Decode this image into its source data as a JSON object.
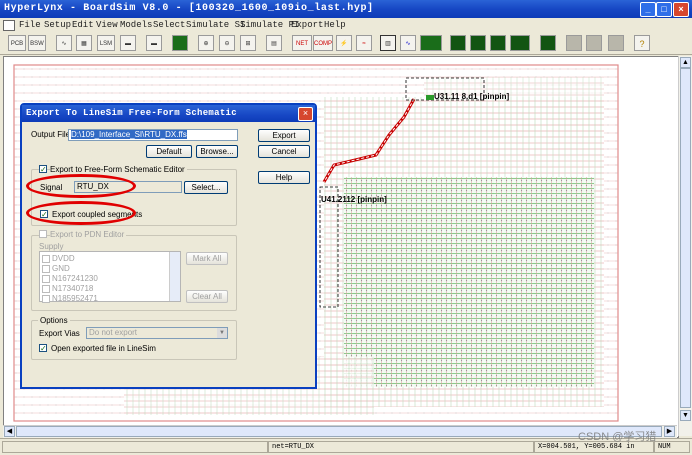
{
  "app": {
    "title": "HyperLynx - BoardSim V8.0 - [100320_1600_109io_last.hyp]"
  },
  "menu": [
    "File",
    "Setup",
    "Edit",
    "View",
    "Models",
    "Select",
    "Simulate SI",
    "Simulate PI",
    "Export",
    "Help"
  ],
  "toolbar": {
    "buttons": [
      "PCB",
      "BSW",
      "LSM",
      "NET",
      "COMP",
      "?"
    ]
  },
  "canvas": {
    "net_label_top": "U31.11 8.d1 [pinpin]",
    "net_label_mid": "U41.2112 [pinpin]"
  },
  "dialog": {
    "title": "Export To LineSim Free-Form Schematic",
    "output_file_label": "Output File",
    "output_file_value": "D:\\109_Interface_SI\\RTU_DX.ffs",
    "export_button": "Export",
    "cancel_button": "Cancel",
    "help_button": "Help",
    "default_button": "Default",
    "browse_button": "Browse...",
    "export_ffs_label": "Export to Free-Form Schematic Editor",
    "signal_label": "Signal",
    "signal_value": "RTU_DX",
    "select_button": "Select...",
    "export_coupled_label": "Export coupled segments",
    "export_pdn_label": "Export to PDN Editor",
    "supply_label": "Supply",
    "supply_items": [
      "DVDD",
      "GND",
      "N167241230",
      "N17340718",
      "N185952471"
    ],
    "mark_all_button": "Mark All",
    "clear_all_button": "Clear All",
    "options_label": "Options",
    "export_vias_label": "Export Vias",
    "export_vias_value": "Do not export",
    "open_exported_label": "Open exported file in LineSim"
  },
  "status": {
    "net": "net=RTU_DX",
    "coords": "X=004.501, Y=005.684 in",
    "mode": "NUM"
  },
  "watermark": "CSDN @学习猎"
}
